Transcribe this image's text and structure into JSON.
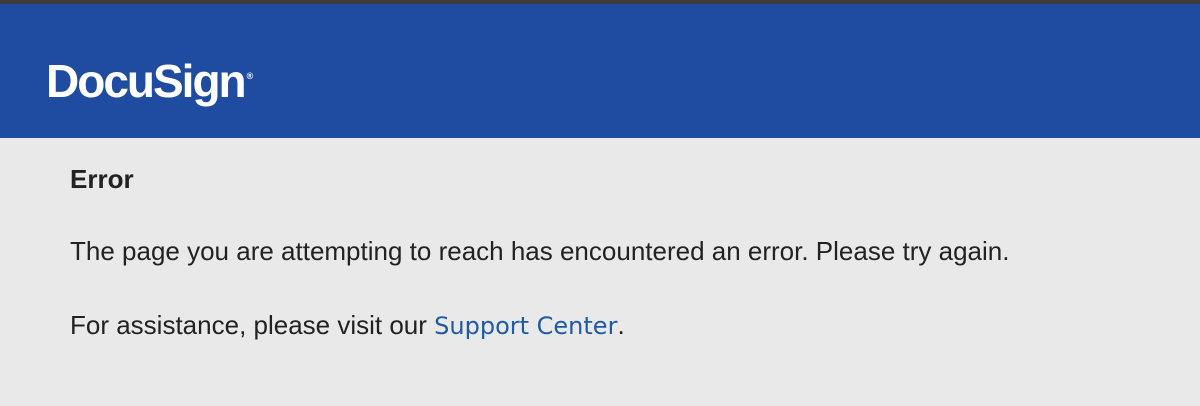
{
  "header": {
    "logo_text": "DocuSign",
    "logo_mark": "®",
    "background_color": "#1f4ca0"
  },
  "error": {
    "title": "Error",
    "message": "The page you are attempting to reach has encountered an error. Please try again.",
    "assist_prefix": "For assistance, please visit our ",
    "link_label": "Support Center",
    "assist_suffix": "."
  },
  "colors": {
    "link": "#1f5aa6",
    "text": "#222222",
    "page_background": "#e9e9e9"
  }
}
